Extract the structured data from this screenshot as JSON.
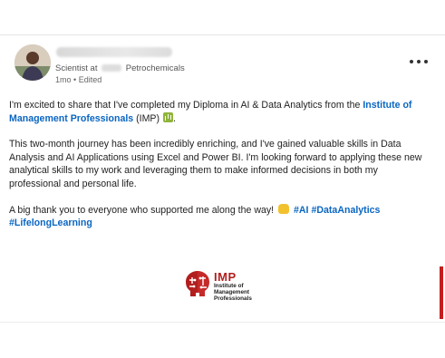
{
  "post": {
    "author": {
      "headline_prefix": "Scientist at",
      "headline_suffix": "Petrochemicals",
      "time": "1mo",
      "separator": "•",
      "edited": "Edited"
    },
    "more_icon": "ellipsis-icon",
    "paragraph1": {
      "text": "I'm excited to share that I've completed my Diploma in AI & Data Analytics from the ",
      "link": "Institute of Management Professionals",
      "after_link": " (IMP) ",
      "emoji": "bar-chart-emoji",
      "end": "."
    },
    "paragraph2": "This two-month journey has been incredibly enriching, and I've gained valuable skills in Data Analysis and AI Applications using Excel and Power BI. I'm looking forward to applying these new analytical skills to my work and leveraging them to make informed decisions in both my professional and personal life.",
    "paragraph3": {
      "text": "A big thank you to everyone who supported me along the way! ",
      "emoji": "raising-hands-emoji",
      "hashtags": [
        "#AI",
        "#DataAnalytics",
        "#LifelongLearning"
      ]
    },
    "image": {
      "logo_title": "IMP",
      "logo_lines": [
        "Institute of",
        "Management",
        "Professionals"
      ],
      "brand_color": "#b21e1e"
    }
  }
}
